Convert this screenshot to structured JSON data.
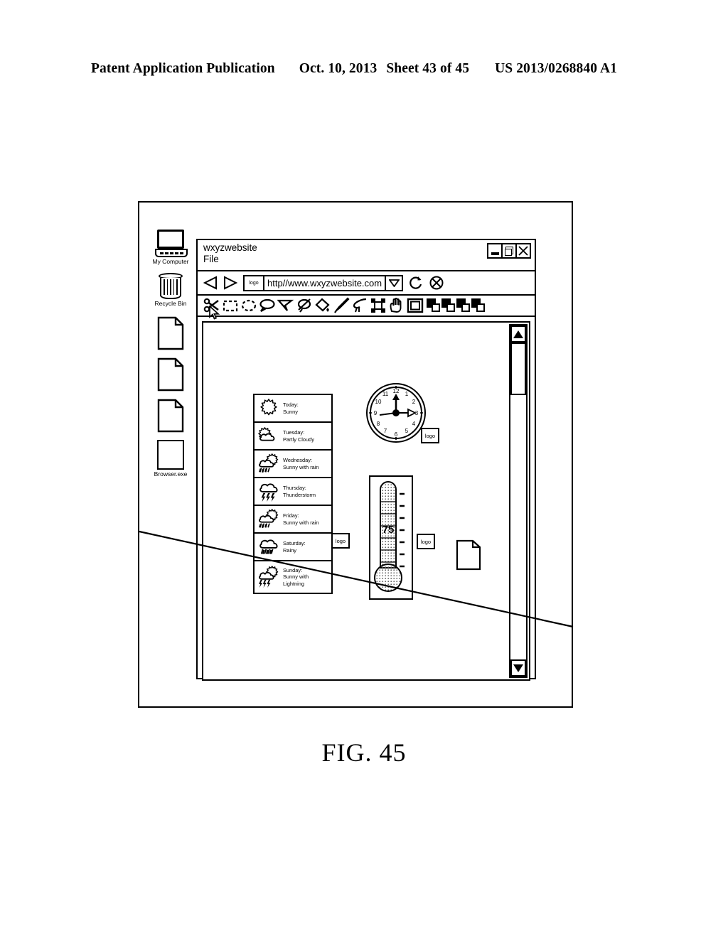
{
  "patent_header": {
    "publication": "Patent Application Publication",
    "date": "Oct. 10, 2013",
    "sheet": "Sheet 43 of 45",
    "patent_number": "US 2013/0268840 A1"
  },
  "figure": {
    "caption": "FIG. 45"
  },
  "desktop": {
    "icons": [
      {
        "label": "My Computer",
        "icon": "computer-icon"
      },
      {
        "label": "Recycle Bin",
        "icon": "recycle-bin-icon"
      },
      {
        "label": "",
        "icon": "document-icon"
      },
      {
        "label": "",
        "icon": "document-icon"
      },
      {
        "label": "",
        "icon": "document-icon"
      },
      {
        "label": "Browser.exe",
        "icon": "application-icon"
      }
    ]
  },
  "browser": {
    "title": "wxyzwebsite",
    "menu": "File",
    "window_controls": [
      {
        "name": "minimize-button",
        "glyph": "minimize-icon"
      },
      {
        "name": "maximize-button",
        "glyph": "restore-icon"
      },
      {
        "name": "close-button",
        "glyph": "close-icon"
      }
    ],
    "navigation": {
      "back_label": "back-icon",
      "forward_label": "forward-icon",
      "url_logo": "logo",
      "url": "http//www.wxyzwebsite.com",
      "dropdown": "chevron-down-icon",
      "refresh": "refresh-icon",
      "stop": "stop-icon"
    },
    "toolbar": {
      "tools": [
        "scissors-icon",
        "rectangle-select-icon",
        "ellipse-select-icon",
        "speech-lasso-icon",
        "polygon-lasso-icon",
        "magic-wand-icon",
        "paint-bucket-icon",
        "brush-icon",
        "eyedropper-icon",
        "crop-icon",
        "hand-icon",
        "frame-icon"
      ],
      "swatch_count": 4
    },
    "cursor": "mouse-pointer-icon",
    "scrollbar": {
      "up": "scroll-up-arrow",
      "down": "scroll-down-arrow",
      "thumb": "scroll-thumb"
    }
  },
  "page_content": {
    "weather_widget": {
      "rows": [
        {
          "day": "Today:",
          "condition": "Sunny",
          "icon": "sun-icon"
        },
        {
          "day": "Tuesday:",
          "condition": "Partly Cloudy",
          "icon": "sun-cloud-icon"
        },
        {
          "day": "Wednesday:",
          "condition": "Sunny with rain",
          "icon": "sun-cloud-rain-icon"
        },
        {
          "day": "Thursday:",
          "condition": "Thunderstorm",
          "icon": "cloud-lightning-icon"
        },
        {
          "day": "Friday:",
          "condition": "Sunny with rain",
          "icon": "sun-cloud-rain-icon"
        },
        {
          "day": "Saturday:",
          "condition": "Rainy",
          "icon": "cloud-rain-icon"
        },
        {
          "day": "Sunday:",
          "condition": "Sunny with Lightning",
          "icon": "sun-cloud-lightning-icon"
        }
      ]
    },
    "clock_widget": {
      "numerals": [
        "12",
        "1",
        "2",
        "3",
        "4",
        "5",
        "6",
        "7",
        "8",
        "9",
        "10",
        "11"
      ],
      "hour_hand": "9",
      "minute_hand": "12",
      "second_hand": "3",
      "logo": "logo"
    },
    "thermometer_widget": {
      "reading": "75",
      "logo": "logo"
    },
    "weather_logo": "logo",
    "document_icon": "document-icon"
  }
}
